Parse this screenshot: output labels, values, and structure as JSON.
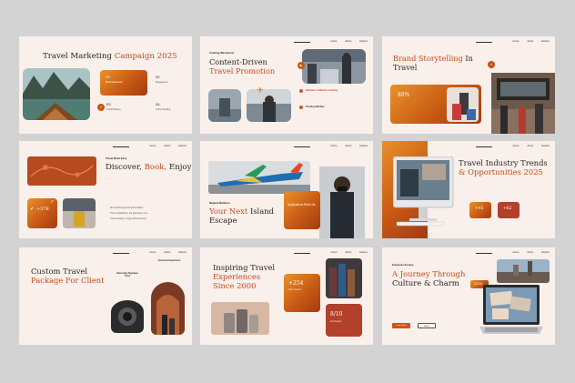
{
  "nav": [
    "Home",
    "About",
    "Explore"
  ],
  "slides": {
    "s1": {
      "title_a": "Travel Marketing ",
      "title_b": "Campaign 2025",
      "n1": "01.",
      "n1_label": "Brand Awareness",
      "n2": "02.",
      "n2_label": "Engagement",
      "n3": "03.",
      "n3_label": "Social Sharing",
      "n4": "04.",
      "n4_label": "Online Booking"
    },
    "s2": {
      "kicker": "Creating Wanderlust",
      "title_a": "Content-Driven",
      "title_b": "Travel Promotion",
      "b1": "Definition of Machine Learning",
      "b2": "Trusting with Bias"
    },
    "s3": {
      "title_a": "Brand Storytelling ",
      "title_b": "In",
      "title_c": "Travel",
      "pct": "88%"
    },
    "s4": {
      "kicker": "Travel Made Easy",
      "title_a": "Discover, ",
      "title_b": "Book, ",
      "title_c": "Enjoy",
      "stat": "+578",
      "b1": "All trip itinerary photo presentation",
      "b2": "Trip & notifications, trip planning in one",
      "b3": "Travel savings, energy efficient prices"
    },
    "s5": {
      "kicker": "Magical Maldives",
      "title_a": "Your Next ",
      "title_b": "Island",
      "title_c": "Escape",
      "card": "Applications Role Life"
    },
    "s6": {
      "title_a": "Travel Industry Trends",
      "title_b": "& Opportunities 2025",
      "c1": "+45",
      "c2": "+62"
    },
    "s7": {
      "title_a": "Custom Travel",
      "title_b": "Package For Client",
      "l1": "Interesting Signature Tours",
      "l2": "Customer Experience"
    },
    "s8": {
      "title_a": "Inspiring Travel",
      "title_b": "Experiences",
      "title_c": "Since 2000",
      "stat1": "+254",
      "stat2": "8/10",
      "stat1_label": "Client Stories",
      "stat2_label": "Net Ratings"
    },
    "s9": {
      "kicker": "European Escape",
      "title_a": "A Journey Through",
      "title_b": "Culture & Charm",
      "year": "2025",
      "btn1": "Learn More",
      "btn2": "Book"
    }
  },
  "colors": {
    "accent": "#c44a1c",
    "orange": "#e8912a",
    "bg": "#faf0eb",
    "frame": "#d3d3d3"
  }
}
